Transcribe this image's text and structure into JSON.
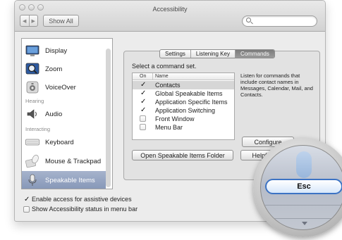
{
  "window": {
    "title": "Accessibility"
  },
  "toolbar": {
    "back_glyph": "◀",
    "forward_glyph": "▶",
    "show_all_label": "Show All",
    "search_placeholder": ""
  },
  "sidebar": {
    "items": [
      {
        "label": "Display",
        "icon": "display-icon"
      },
      {
        "label": "Zoom",
        "icon": "zoom-icon"
      },
      {
        "label": "VoiceOver",
        "icon": "voiceover-icon"
      },
      {
        "label": "Audio",
        "icon": "audio-icon"
      },
      {
        "label": "Keyboard",
        "icon": "keyboard-icon"
      },
      {
        "label": "Mouse & Trackpad",
        "icon": "mouse-trackpad-icon"
      },
      {
        "label": "Speakable Items",
        "icon": "microphone-icon",
        "selected": true
      }
    ],
    "headers": {
      "hearing": "Hearing",
      "interacting": "Interacting"
    }
  },
  "tabs": [
    {
      "label": "Settings"
    },
    {
      "label": "Listening Key"
    },
    {
      "label": "Commands",
      "active": true
    }
  ],
  "commands": {
    "instruction": "Select a command set.",
    "col_on": "On",
    "col_name": "Name",
    "rows": [
      {
        "name": "Contacts",
        "checked": true,
        "selected": true
      },
      {
        "name": "Global Speakable Items",
        "checked": true
      },
      {
        "name": "Application Specific Items",
        "checked": true
      },
      {
        "name": "Application Switching",
        "checked": true
      },
      {
        "name": "Front Window",
        "checked": false
      },
      {
        "name": "Menu Bar",
        "checked": false
      }
    ],
    "description": "Listen for commands that include contact names in Messages, Calendar, Mail, and Contacts.",
    "configure_label": "Configure",
    "open_folder_label": "Open Speakable Items Folder",
    "helpful_tips_label": "Helpful Tips"
  },
  "footer": {
    "enable_access_label": "Enable access for assistive devices",
    "enable_access_checked": true,
    "show_status_label": "Show Accessibility status in menu bar",
    "show_status_checked": false
  },
  "magnifier": {
    "key_label": "Esc"
  },
  "glyphs": {
    "check": "✓"
  }
}
